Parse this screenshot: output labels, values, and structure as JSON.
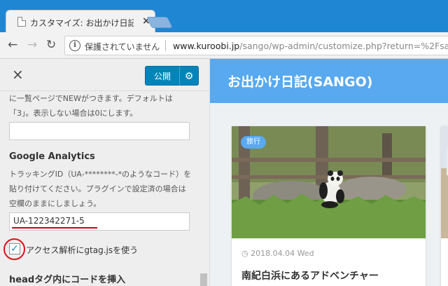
{
  "browser": {
    "tab_title": "カスタマイズ: お出かけ日記(S",
    "tab_close": "×",
    "security_text": "保護されていません",
    "url_host": "www.kuroobi.jp",
    "url_path": "/sango/wp-admin/customize.php?return=%2Fsan"
  },
  "customizer": {
    "close": "×",
    "publish_label": "公開",
    "desc_top": "に一覧ページでNEWがつきます。デフォルトは「3」。表示しない場合は0にします。",
    "ga_heading": "Google Analytics",
    "ga_desc": "トラッキングID（UA-********-*のようなコード）を貼り付けてください。プラグインで設定済の場合は空欄のままにしましょう。",
    "ga_value": "UA-122342271-5",
    "gtag_checkbox_label": "アクセス解析にgtag.jsを使う",
    "gtag_checked": true,
    "head_heading": "headタグ内にコードを挿入"
  },
  "preview": {
    "site_title": "お出かけ日記(SANGO)",
    "card": {
      "category": "旅行",
      "date": "◷ 2018.04.04 Wed",
      "title": "南紀白浜にあるアドベンチャー"
    }
  },
  "colors": {
    "chrome_blue": "#1f86d3",
    "publish_blue": "#0085ba",
    "site_header": "#58a9ef",
    "annotation_red": "#e0101a"
  }
}
